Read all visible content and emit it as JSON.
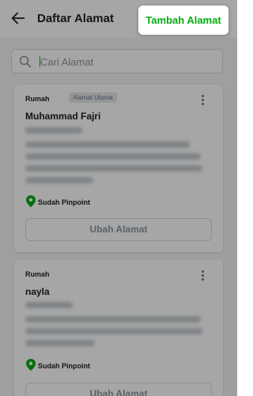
{
  "header": {
    "back_icon": "arrow-left-icon",
    "title": "Daftar Alamat",
    "add_button": "Tambah Alamat"
  },
  "search": {
    "placeholder": "Cari Alamat",
    "icon": "search-icon"
  },
  "addresses": [
    {
      "label": "Rumah",
      "badge": "Alamat Utama",
      "name": "Muhammad Fajri",
      "pinpoint_status": "Sudah Pinpoint",
      "edit_button": "Ubah Alamat"
    },
    {
      "label": "Rumah",
      "name": "nayla",
      "pinpoint_status": "Sudah Pinpoint",
      "edit_button": "Ubah Alamat"
    }
  ],
  "colors": {
    "accent": "#03ac0e",
    "overlay": "rgba(0,0,0,0.35)"
  }
}
